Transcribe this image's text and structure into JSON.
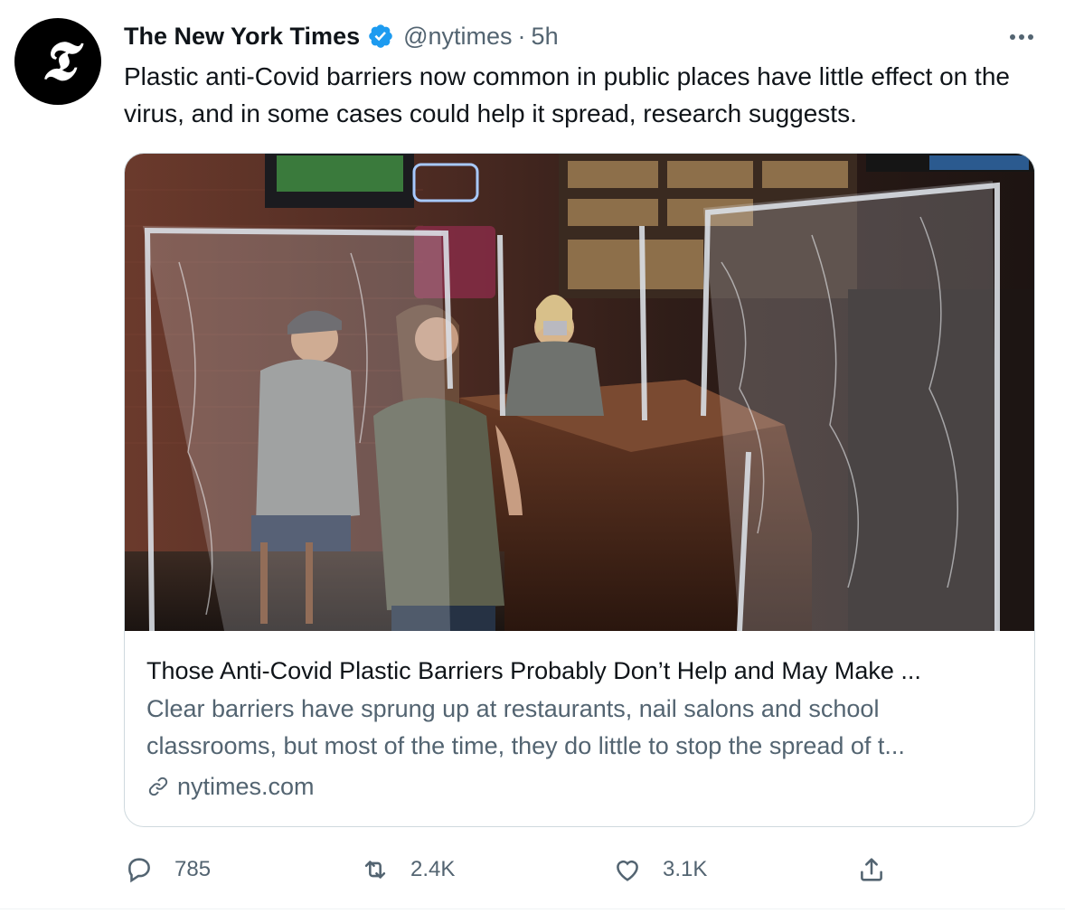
{
  "tweet": {
    "avatar_glyph": "𝕿",
    "display_name": "The New York Times",
    "handle": "@nytimes",
    "separator": "·",
    "time": "5h",
    "text": "Plastic anti-Covid barriers now common in public places have little effect on the virus, and in some cases could help it spread, research suggests.",
    "card": {
      "title": "Those Anti-Covid Plastic Barriers Probably Don’t Help and May Make ...",
      "description": "Clear barriers have sprung up at restaurants, nail salons and school classrooms, but most of the time, they do little to stop the spread of t...",
      "domain": "nytimes.com",
      "image_icon": "bar-with-plastic-barriers-photo"
    },
    "actions": {
      "reply_count": "785",
      "retweet_count": "2.4K",
      "like_count": "3.1K"
    }
  },
  "colors": {
    "text_primary": "#0f1419",
    "text_secondary": "#536471",
    "verified_blue": "#1d9bf0",
    "border": "#cfd9de"
  }
}
